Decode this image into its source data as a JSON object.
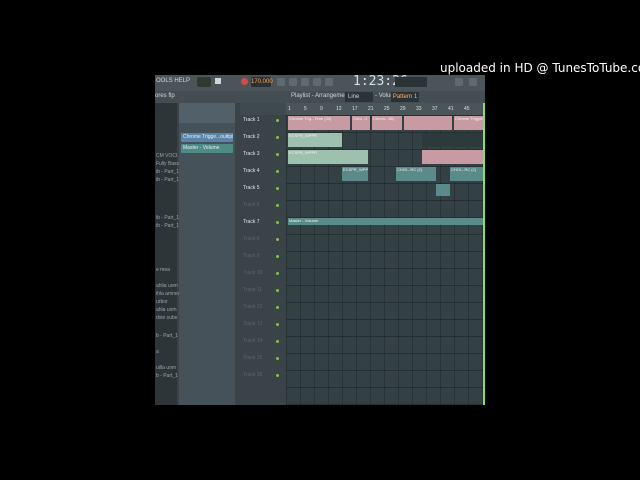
{
  "watermark": "uploaded in HD @ TunesToTube.com",
  "toolbar": {
    "menu_label": "OOLS  HELP",
    "tempo": "170.000",
    "time": "1:23:26",
    "pattern": "Pattern 1",
    "line_mode": "Line",
    "options_label": "ores flp"
  },
  "playlist": {
    "breadcrumb": "Playlist - Arrangement - Master - Volume -"
  },
  "ruler_ticks": [
    "1",
    "5",
    "9",
    "13",
    "17",
    "21",
    "25",
    "29",
    "33",
    "37",
    "41",
    "45"
  ],
  "channels": [
    {
      "label": "Chrome Trigge...ouitipla",
      "color": "#5a84a8"
    },
    {
      "label": "Master - Volume",
      "color": "#4e8a86"
    }
  ],
  "tracks": [
    {
      "label": "Track 1",
      "active": true
    },
    {
      "label": "Track 2",
      "active": true
    },
    {
      "label": "Track 3",
      "active": true
    },
    {
      "label": "Track 4",
      "active": true
    },
    {
      "label": "Track 5",
      "active": true
    },
    {
      "label": "Track 6",
      "active": false
    },
    {
      "label": "Track 7",
      "active": true
    },
    {
      "label": "Track 8",
      "active": false
    },
    {
      "label": "Track 9",
      "active": false
    },
    {
      "label": "Track 10",
      "active": false
    },
    {
      "label": "Track 11",
      "active": false
    },
    {
      "label": "Track 12",
      "active": false
    },
    {
      "label": "Track 13",
      "active": false
    },
    {
      "label": "Track 14",
      "active": false
    },
    {
      "label": "Track 15",
      "active": false
    },
    {
      "label": "Track 16",
      "active": false
    }
  ],
  "browser_items": [
    "CM VOCI",
    "Fully Bass",
    "ib - Part_1",
    "ib - Part_1",
    "ib - Part_1",
    "ib - Part_1",
    "e mea",
    "ahlia uom",
    "ihla amnesa",
    "urbor",
    "ahla uom",
    "dvie sube",
    "b - Part_1",
    "a",
    "uilla uom",
    "b - Part_1"
  ],
  "clips": {
    "t1_a": "Chrome Trig...Time (34)",
    "t1_b": "Chro...1",
    "t1_c": "Chrom...36)",
    "t1_d": "Chrome Trigger",
    "t2_a": "ECSPR_WPPR",
    "t3_a": "ECSPR_WPPR",
    "t4_a": "ECSPR_WPPR",
    "t4_b": "CHOI...RC (2)",
    "t4_c": "CHOI...RC (2)",
    "t7_a": "Master - Volume"
  }
}
